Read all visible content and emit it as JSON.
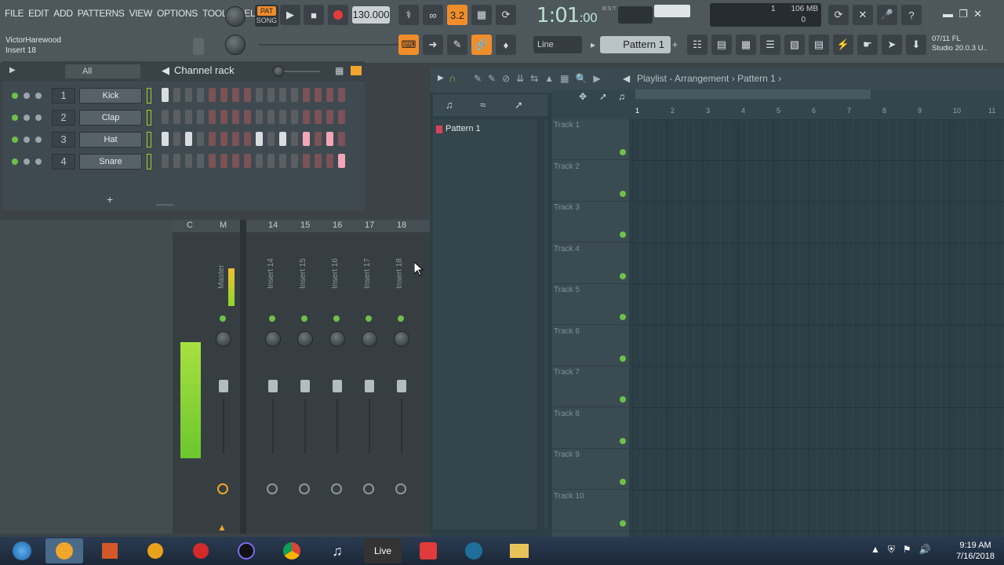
{
  "menu": [
    "FILE",
    "EDIT",
    "ADD",
    "PATTERNS",
    "VIEW",
    "OPTIONS",
    "TOOLS",
    "HELP"
  ],
  "hint": {
    "user": "VictorHarewood",
    "target": "Insert 18"
  },
  "transport": {
    "pat": "PAT",
    "song": "SONG",
    "tempo": "130.000",
    "time": "1:01",
    "time_small": ":00",
    "bst": "B:S:T"
  },
  "memory": {
    "cpu": "1",
    "mem": "106 MB",
    "poly": "0"
  },
  "snap": "Line",
  "pattern_selector": "Pattern 1",
  "fl_info": {
    "line1": "07/11  FL",
    "line2": "Studio 20.0.3 U.."
  },
  "channel_rack": {
    "filter": "All",
    "title": "Channel rack",
    "add": "+",
    "channels": [
      {
        "num": "1",
        "name": "Kick",
        "steps": [
          1,
          0,
          0,
          0,
          0,
          0,
          0,
          0,
          0,
          0,
          0,
          0,
          0,
          0,
          0,
          0
        ]
      },
      {
        "num": "2",
        "name": "Clap",
        "steps": [
          0,
          0,
          0,
          0,
          0,
          0,
          0,
          0,
          0,
          0,
          0,
          0,
          0,
          0,
          0,
          0
        ]
      },
      {
        "num": "3",
        "name": "Hat",
        "steps": [
          1,
          0,
          1,
          0,
          0,
          0,
          0,
          0,
          1,
          0,
          1,
          0,
          1,
          0,
          1,
          0
        ]
      },
      {
        "num": "4",
        "name": "Snare",
        "steps": [
          0,
          0,
          0,
          0,
          0,
          0,
          0,
          0,
          0,
          0,
          0,
          0,
          0,
          0,
          0,
          1
        ]
      }
    ]
  },
  "mixer": {
    "header": [
      "C",
      "M",
      "14",
      "15",
      "16",
      "17",
      "18"
    ],
    "strips": [
      "Master",
      "Insert 14",
      "Insert 15",
      "Insert 16",
      "Insert 17",
      "Insert 18"
    ]
  },
  "playlist": {
    "title": "Playlist - Arrangement",
    "breadcrumb_sep": "›",
    "pattern": "Pattern 1",
    "pattern_item": "Pattern 1",
    "ruler": [
      "1",
      "2",
      "3",
      "4",
      "5",
      "6",
      "7",
      "8",
      "9",
      "10",
      "11"
    ],
    "tracks": [
      "Track 1",
      "Track 2",
      "Track 3",
      "Track 4",
      "Track 5",
      "Track 6",
      "Track 7",
      "Track 8",
      "Track 9",
      "Track 10"
    ]
  },
  "taskbar": {
    "live": "Live",
    "time": "9:19 AM",
    "date": "7/16/2018"
  }
}
